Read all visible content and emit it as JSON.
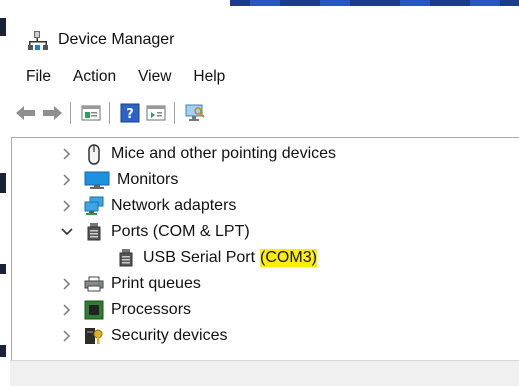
{
  "window": {
    "title": "Device Manager"
  },
  "menubar": {
    "items": [
      "File",
      "Action",
      "View",
      "Help"
    ]
  },
  "toolbar": {
    "buttons": [
      "back-arrow-icon",
      "forward-arrow-icon",
      "properties-icon",
      "help-icon",
      "update-driver-icon",
      "scan-hardware-icon"
    ]
  },
  "tree": {
    "nodes": [
      {
        "label": "Mice and other pointing devices",
        "expanded": false,
        "icon": "mouse-icon"
      },
      {
        "label": "Monitors",
        "expanded": false,
        "icon": "monitor-icon"
      },
      {
        "label": "Network adapters",
        "expanded": false,
        "icon": "network-adapter-icon"
      },
      {
        "label": "Ports (COM & LPT)",
        "expanded": true,
        "icon": "port-icon"
      },
      {
        "label_prefix": "USB Serial Port",
        "label_highlight": "(COM3)",
        "child": true,
        "icon": "port-icon"
      },
      {
        "label": "Print queues",
        "expanded": false,
        "icon": "printer-icon"
      },
      {
        "label": "Processors",
        "expanded": false,
        "icon": "processor-icon"
      },
      {
        "label": "Security devices",
        "expanded": false,
        "icon": "security-device-icon"
      }
    ]
  },
  "colors": {
    "highlight": "#ffee00",
    "monitor_blue": "#1e90e0",
    "processor_green": "#2e7d32"
  }
}
